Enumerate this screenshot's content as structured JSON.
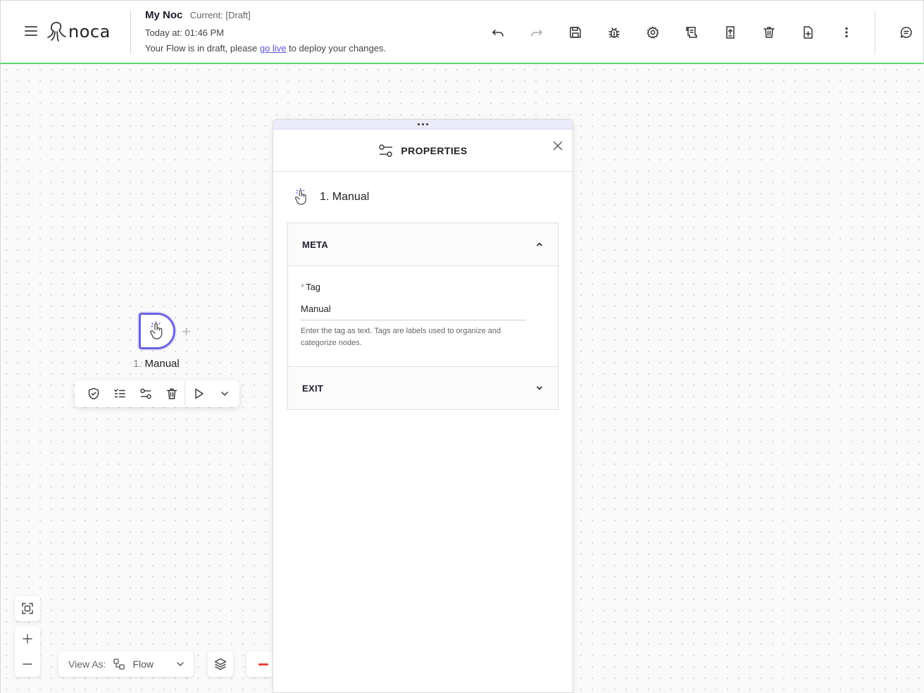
{
  "header": {
    "logo_text": "noca",
    "title": "My Noc",
    "version": "Current: [Draft]",
    "time": "Today at: 01:46 PM",
    "message_prefix": "Your Flow is in draft, please",
    "message_link": "go live",
    "message_suffix": "to deploy your changes.",
    "toolbar_icons": [
      "undo-icon",
      "redo-icon",
      "save-icon",
      "debug-icon",
      "settings-icon",
      "logs-icon",
      "publish-icon",
      "delete-icon",
      "new-file-icon",
      "more-icon"
    ],
    "chat_icon": "chat-icon"
  },
  "canvas": {
    "node": {
      "number": "1.",
      "label": "Manual",
      "icon": "hand-click-icon"
    },
    "node_toolbar_icons": [
      "shield-icon",
      "checklist-icon",
      "properties-icon",
      "delete-icon",
      "play-icon",
      "chevron-down-icon"
    ]
  },
  "controls": {
    "view_as_label": "View As:",
    "view_as_value": "Flow",
    "status_color": "#e8463b"
  },
  "panel": {
    "title": "PROPERTIES",
    "node_label": "1. Manual",
    "sections": {
      "meta": {
        "title": "META",
        "tag_required": "*",
        "tag_label": "Tag",
        "tag_value": "Manual",
        "tag_help": "Enter the tag as text. Tags are labels used to organize and categorize nodes."
      },
      "exit": {
        "title": "EXIT"
      }
    }
  },
  "colors": {
    "accent": "#6a63e0",
    "header_border": "#5bd96b",
    "link": "#5b55d6"
  }
}
